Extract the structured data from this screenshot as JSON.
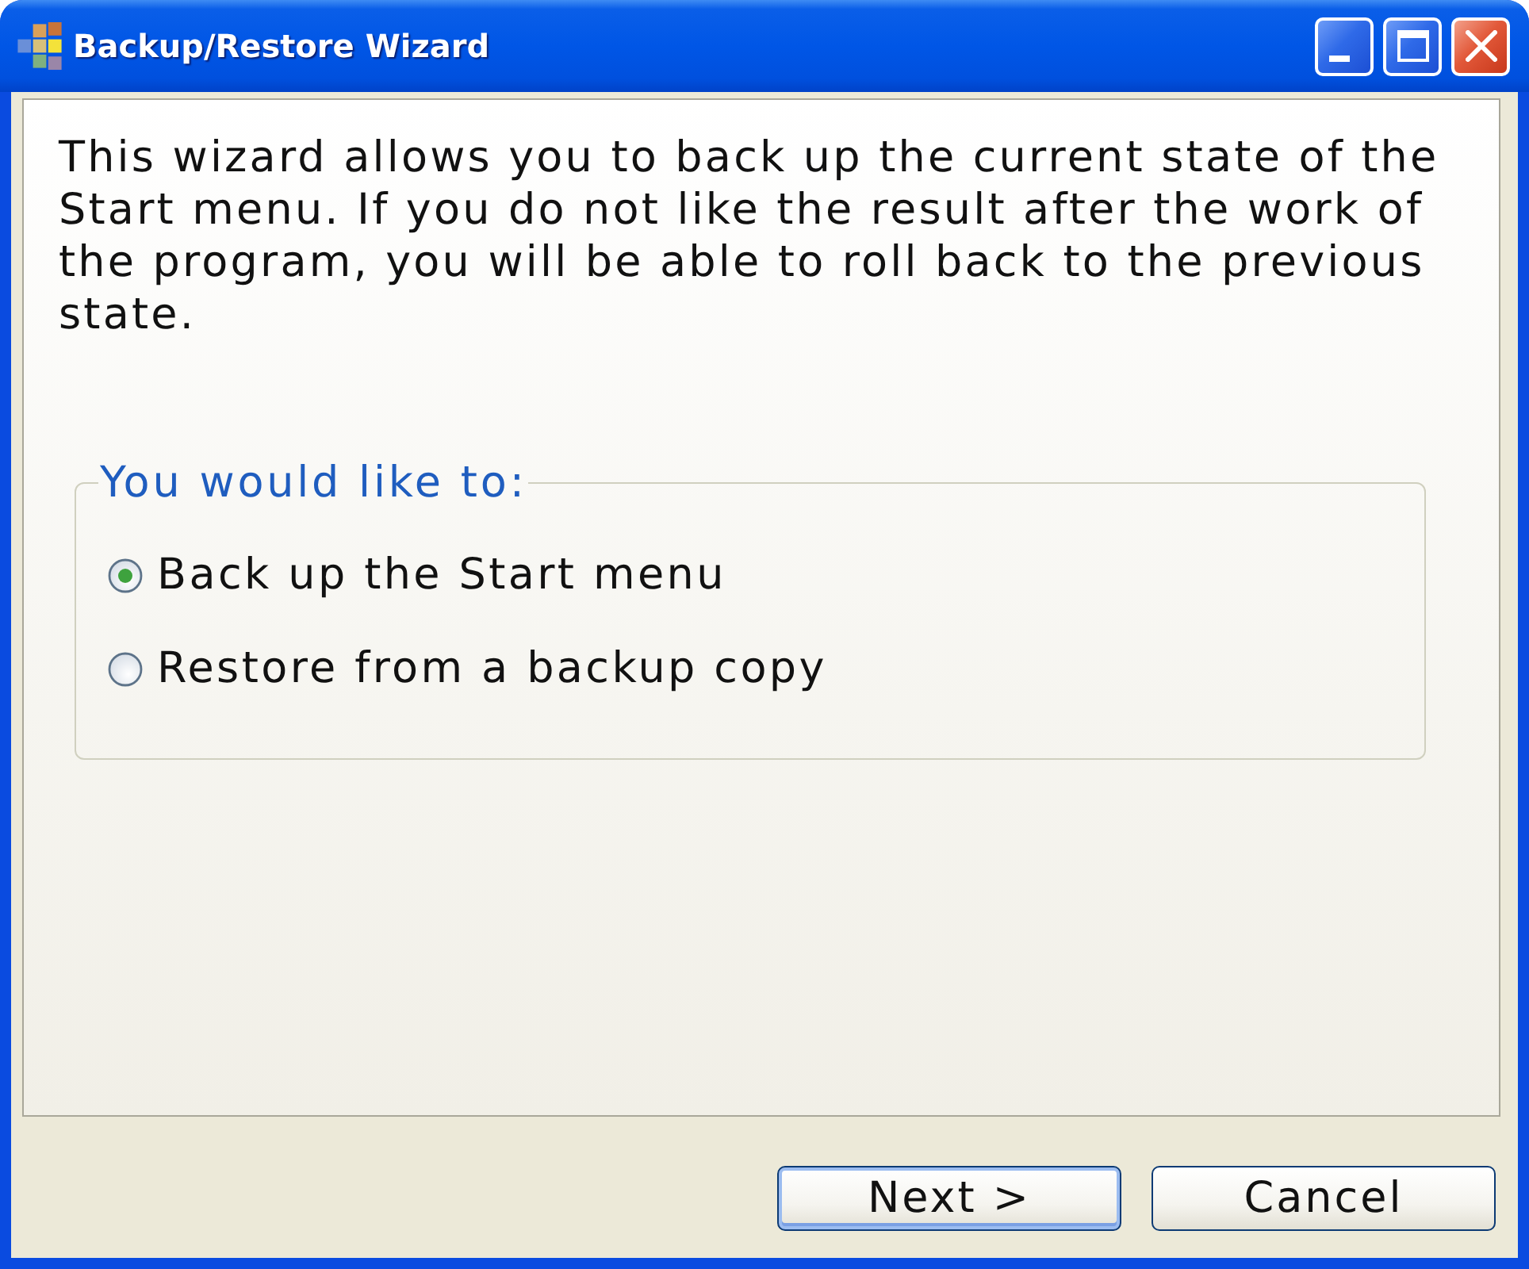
{
  "window": {
    "title": "Backup/Restore Wizard"
  },
  "intro": "This wizard allows you to back up the current state of the Start menu. If you do not like the result after the work of the program, you will be able to roll back to the previous state.",
  "options_group": {
    "legend": "You would like to:",
    "options": [
      {
        "label": "Back up the Start menu",
        "selected": true
      },
      {
        "label": "Restore from a backup copy",
        "selected": false
      }
    ]
  },
  "buttons": [
    {
      "label": "Next >",
      "default": true
    },
    {
      "label": "Cancel",
      "default": false
    }
  ]
}
